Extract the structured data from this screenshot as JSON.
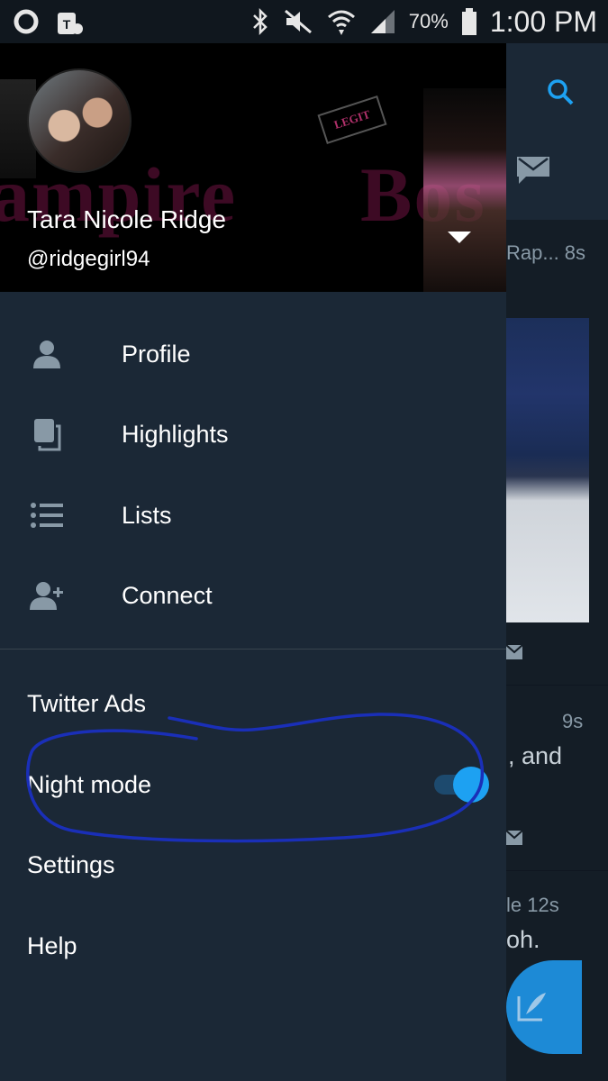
{
  "status_bar": {
    "battery_percent": "70%",
    "time": "1:00 PM",
    "icons": [
      "sync-icon",
      "tmobile-icon",
      "bluetooth-icon",
      "mute-icon",
      "wifi-icon",
      "signal-icon",
      "battery-icon"
    ]
  },
  "drawer": {
    "user": {
      "name": "Tara Nicole Ridge",
      "handle": "@ridgegirl94"
    },
    "header_art": {
      "stamp_text": "LEGIT",
      "text_left": "ampire",
      "text_right": "Bos"
    },
    "menu": [
      {
        "label": "Profile",
        "icon": "profile-icon"
      },
      {
        "label": "Highlights",
        "icon": "highlights-icon"
      },
      {
        "label": "Lists",
        "icon": "lists-icon"
      },
      {
        "label": "Connect",
        "icon": "connect-icon"
      }
    ],
    "secondary": {
      "twitter_ads": "Twitter Ads",
      "night_mode": "Night mode",
      "night_mode_enabled": true,
      "settings": "Settings",
      "help": "Help"
    }
  },
  "timeline_peek": {
    "tweet1_meta": "Rap... 8s",
    "tweet2_time": "9s",
    "tweet2_text": ", and",
    "tweet3_meta": "le  12s",
    "tweet3_text": "oh."
  },
  "colors": {
    "background": "#15202b",
    "drawer": "#1b2836",
    "accent": "#1da1f2",
    "annotation": "#1a2fb8"
  }
}
